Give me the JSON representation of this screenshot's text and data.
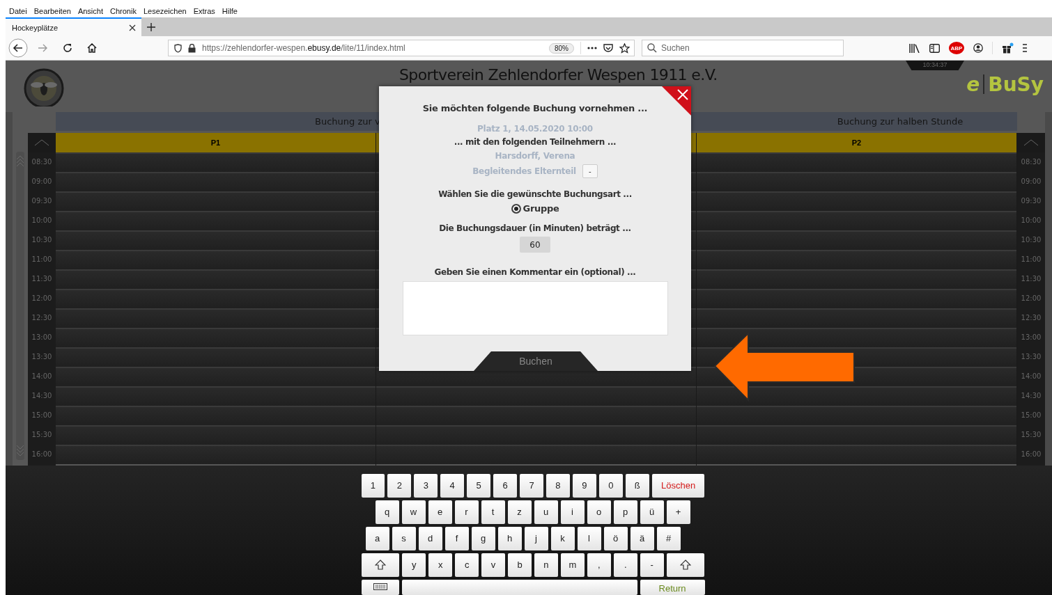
{
  "browser": {
    "menu": [
      "Datei",
      "Bearbeiten",
      "Ansicht",
      "Chronik",
      "Lesezeichen",
      "Extras",
      "Hilfe"
    ],
    "tabs": [
      {
        "title": "Hockeyplätze",
        "selected": true
      }
    ],
    "url": {
      "prefix": "https://zehlendorfer-wespen.",
      "domain": "ebusy.de",
      "path": "/lite/11/index.html"
    },
    "zoom": "80%",
    "search": {
      "placeholder": "Suchen"
    },
    "adblock": "ABP"
  },
  "header": {
    "title": "Sportverein Zehlendorfer Wespen 1911 e.V.",
    "clock": "10:34:37",
    "brand_prefix": "e",
    "brand": "BuSy"
  },
  "sections": [
    {
      "title": "Buchung zur v"
    },
    {
      "title": "Buchung zur halben Stunde"
    }
  ],
  "courts": [
    {
      "label": "P1"
    },
    {
      "label": "P2"
    }
  ],
  "time_columns": [
    {
      "times": [
        "08:30",
        "09:00",
        "09:30",
        "10:00",
        "10:30",
        "11:00",
        "11:30",
        "12:00",
        "12:30",
        "13:00",
        "13:30",
        "14:00",
        "14:30",
        "15:00",
        "15:30",
        "16:00"
      ]
    },
    {
      "times": [
        "08:30",
        "09:00",
        "09:30",
        "10:00",
        "10:30",
        "11:00",
        "11:30",
        "12:00",
        "12:30",
        "13:00",
        "13:30",
        "14:00",
        "14:30",
        "15:00",
        "15:30",
        "16:00"
      ]
    }
  ],
  "modal": {
    "title": "Sie möchten folgende Buchung vornehmen ...",
    "booking": "Platz 1, 14.05.2020 10:00",
    "participants_label": "... mit den folgenden Teilnehmern ...",
    "participants": [
      {
        "name": "Harsdorff, Verena"
      },
      {
        "name": "Begleitendes Elternteil",
        "button": "-"
      }
    ],
    "type_label": "Wählen Sie die gewünschte Buchungsart ...",
    "booking_types": [
      {
        "label": "Gruppe",
        "selected": true
      }
    ],
    "duration_label": "Die Buchungsdauer (in Minuten) beträgt ...",
    "duration": "60",
    "comment_label": "Geben Sie einen Kommentar ein (optional) ...",
    "submit": "Buchen"
  },
  "keyboard": {
    "rows": [
      [
        {
          "kind": "char",
          "label": "1"
        },
        {
          "kind": "char",
          "label": "2"
        },
        {
          "kind": "char",
          "label": "3"
        },
        {
          "kind": "char",
          "label": "4"
        },
        {
          "kind": "char",
          "label": "5"
        },
        {
          "kind": "char",
          "label": "6"
        },
        {
          "kind": "char",
          "label": "7"
        },
        {
          "kind": "char",
          "label": "8"
        },
        {
          "kind": "char",
          "label": "9"
        },
        {
          "kind": "char",
          "label": "0"
        },
        {
          "kind": "char",
          "label": "ß"
        },
        {
          "kind": "delete",
          "label": "Löschen"
        }
      ],
      [
        {
          "kind": "char",
          "label": "q"
        },
        {
          "kind": "char",
          "label": "w"
        },
        {
          "kind": "char",
          "label": "e"
        },
        {
          "kind": "char",
          "label": "r"
        },
        {
          "kind": "char",
          "label": "t"
        },
        {
          "kind": "char",
          "label": "z"
        },
        {
          "kind": "char",
          "label": "u"
        },
        {
          "kind": "char",
          "label": "i"
        },
        {
          "kind": "char",
          "label": "o"
        },
        {
          "kind": "char",
          "label": "p"
        },
        {
          "kind": "char",
          "label": "ü"
        },
        {
          "kind": "char",
          "label": "+"
        }
      ],
      [
        {
          "kind": "char",
          "label": "a"
        },
        {
          "kind": "char",
          "label": "s"
        },
        {
          "kind": "char",
          "label": "d"
        },
        {
          "kind": "char",
          "label": "f"
        },
        {
          "kind": "char",
          "label": "g"
        },
        {
          "kind": "char",
          "label": "h"
        },
        {
          "kind": "char",
          "label": "j"
        },
        {
          "kind": "char",
          "label": "k"
        },
        {
          "kind": "char",
          "label": "l"
        },
        {
          "kind": "char",
          "label": "ö"
        },
        {
          "kind": "char",
          "label": "ä"
        },
        {
          "kind": "char",
          "label": "#"
        }
      ],
      [
        {
          "kind": "shift"
        },
        {
          "kind": "char",
          "label": "y"
        },
        {
          "kind": "char",
          "label": "x"
        },
        {
          "kind": "char",
          "label": "c"
        },
        {
          "kind": "char",
          "label": "v"
        },
        {
          "kind": "char",
          "label": "b"
        },
        {
          "kind": "char",
          "label": "n"
        },
        {
          "kind": "char",
          "label": "m"
        },
        {
          "kind": "char",
          "label": ","
        },
        {
          "kind": "char",
          "label": "."
        },
        {
          "kind": "char",
          "label": "-"
        },
        {
          "kind": "shift"
        }
      ]
    ],
    "bottom_keys": [
      {
        "kind": "keyboard"
      },
      {
        "kind": "space"
      },
      {
        "kind": "return",
        "label": "Return"
      }
    ]
  }
}
